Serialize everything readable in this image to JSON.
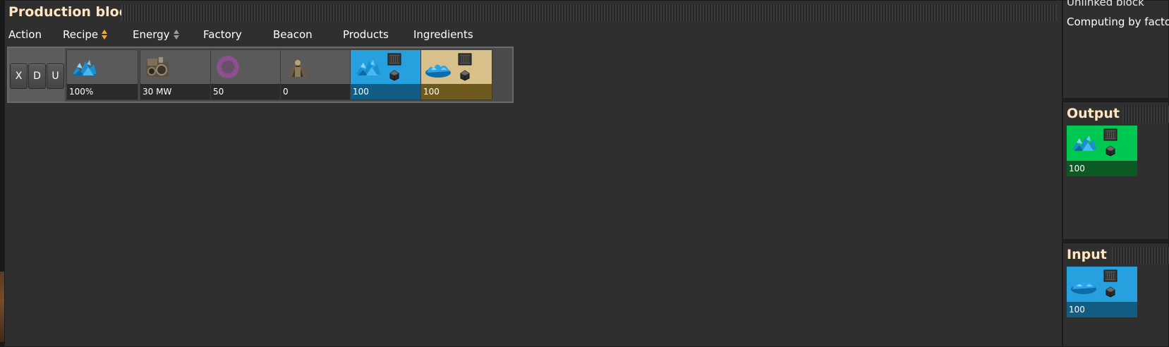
{
  "production_block": {
    "title": "Production block",
    "columns": {
      "action": "Action",
      "recipe": "Recipe",
      "energy": "Energy",
      "factory": "Factory",
      "beacon": "Beacon",
      "products": "Products",
      "ingredients": "Ingredients"
    },
    "row": {
      "actions": [
        "X",
        "D",
        "U"
      ],
      "recipe_value": "100%",
      "energy_value": "30 MW",
      "factory_value": "50",
      "beacon_value": "0",
      "products_value": "100",
      "ingredients_value": "100"
    }
  },
  "side_panel": {
    "status_title": "Unlinked block",
    "status_mode": "Computing by factor",
    "output": {
      "title": "Output",
      "value": "100"
    },
    "input": {
      "title": "Input",
      "value": "100"
    }
  },
  "icons": {
    "recipe": "blue-crystal-icon",
    "energy": "machine-icon",
    "factory": "purple-ring-module-icon",
    "beacon": "beacon-tower-icon",
    "chest": "chest-icon",
    "fuel": "coal-fuel-icon"
  },
  "colors": {
    "title": "#ffe6c0",
    "products": "#27a0e0",
    "ingredients": "#d8c08a",
    "output": "#00c853",
    "input": "#27a0e0"
  }
}
